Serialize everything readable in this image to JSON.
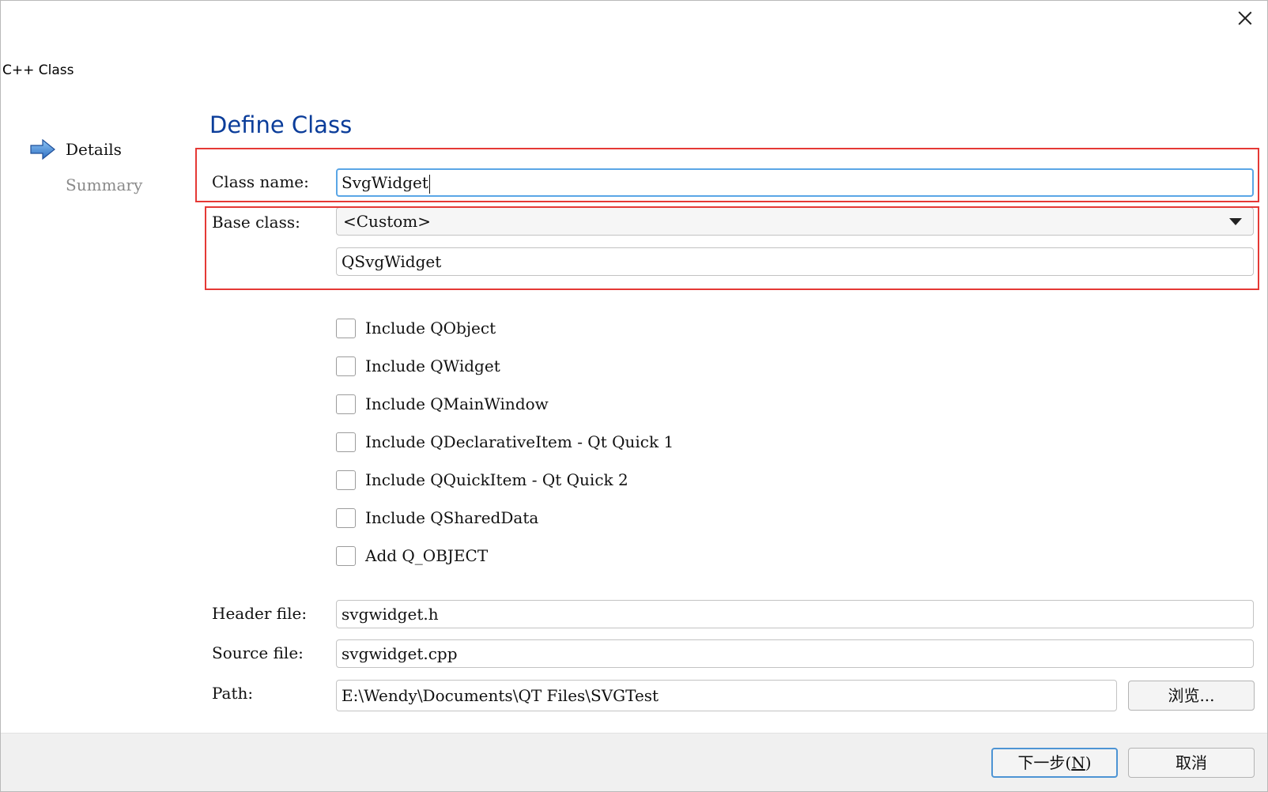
{
  "window": {
    "title": "C++ Class"
  },
  "steps": [
    {
      "label": "Details",
      "active": true
    },
    {
      "label": "Summary",
      "active": false
    }
  ],
  "page": {
    "title": "Define Class"
  },
  "form": {
    "class_name_label": "Class name:",
    "class_name_value": "SvgWidget",
    "base_class_label": "Base class:",
    "base_class_selected": "<Custom>",
    "custom_base_value": "QSvgWidget",
    "header_file_label": "Header file:",
    "header_file_value": "svgwidget.h",
    "source_file_label": "Source file:",
    "source_file_value": "svgwidget.cpp",
    "path_label": "Path:",
    "path_value": "E:\\Wendy\\Documents\\QT Files\\SVGTest",
    "browse_label": "浏览..."
  },
  "checkboxes": [
    {
      "label": "Include QObject",
      "checked": false
    },
    {
      "label": "Include QWidget",
      "checked": false
    },
    {
      "label": "Include QMainWindow",
      "checked": false
    },
    {
      "label": "Include QDeclarativeItem - Qt Quick 1",
      "checked": false
    },
    {
      "label": "Include QQuickItem - Qt Quick 2",
      "checked": false
    },
    {
      "label": "Include QSharedData",
      "checked": false
    },
    {
      "label": "Add Q_OBJECT",
      "checked": false
    }
  ],
  "footer": {
    "next_label_prefix": "下一步(",
    "next_mnemonic": "N",
    "next_label_suffix": ")",
    "cancel_label": "取消"
  },
  "colors": {
    "title_blue": "#0b3d9a",
    "focus_blue": "#5aa6e6",
    "highlight_red": "#e53935",
    "arrow_blue": "#3b82d6"
  },
  "icons": {
    "close": "close-icon",
    "current_step": "arrow-right-icon",
    "dropdown": "chevron-down-icon"
  }
}
